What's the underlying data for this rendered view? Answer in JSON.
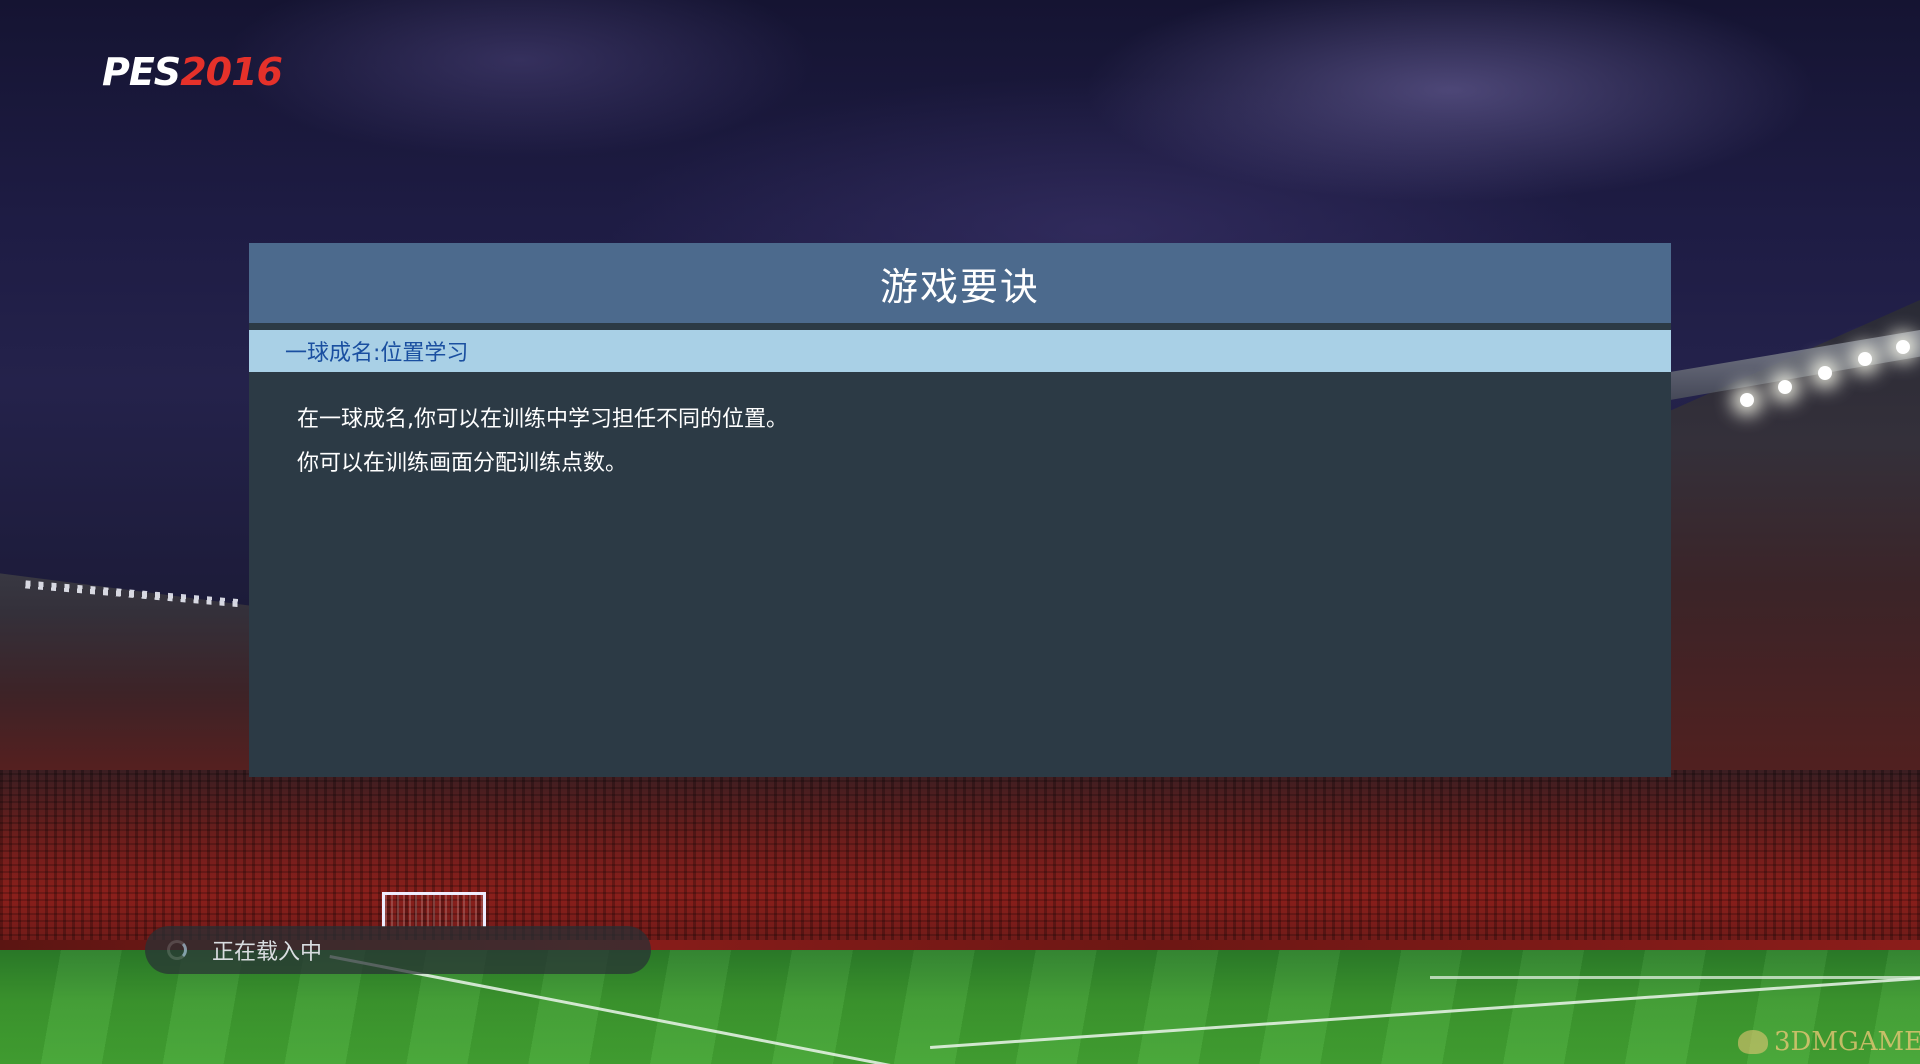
{
  "brand": {
    "logo_pes": "PES",
    "logo_year": "2016",
    "accent_color": "#e5312a"
  },
  "tips": {
    "title": "游戏要诀",
    "subtitle": "一球成名:位置学习",
    "lines": [
      "在一球成名,你可以在训练中学习担任不同的位置。",
      "你可以在训练画面分配训练点数。"
    ],
    "header_color": "#4c6a8d",
    "subheader_color": "#a9d0e6",
    "body_color": "#2c3a45"
  },
  "loading": {
    "label": "正在载入中",
    "icon": "spinner-icon"
  },
  "watermark": {
    "text": "3DMGAME"
  }
}
